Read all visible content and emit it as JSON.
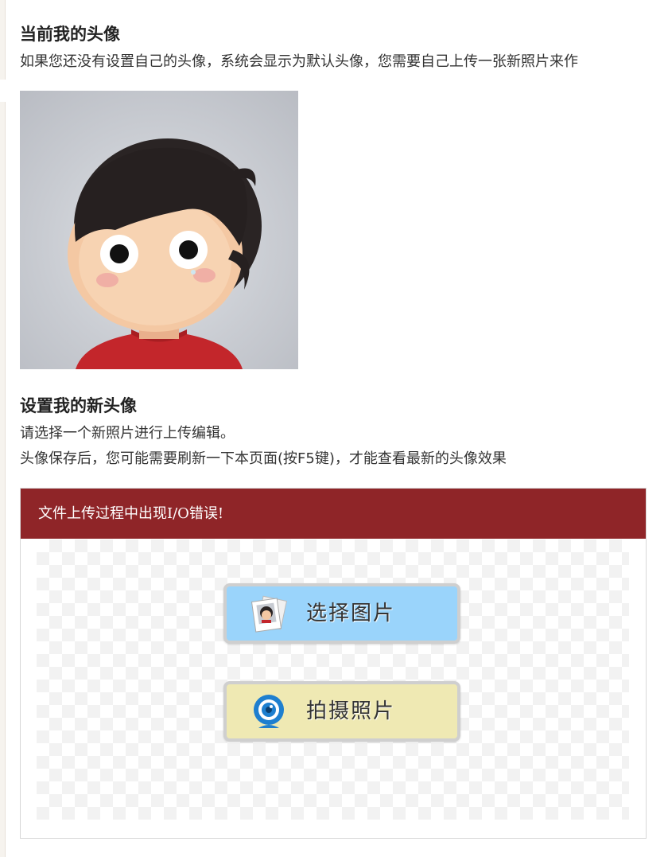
{
  "current_avatar": {
    "title": "当前我的头像",
    "description": "如果您还没有设置自己的头像，系统会显示为默认头像，您需要自己上传一张新照片来作"
  },
  "new_avatar": {
    "title": "设置我的新头像",
    "line1": "请选择一个新照片进行上传编辑。",
    "line2": "头像保存后，您可能需要刷新一下本页面(按F5键)，才能查看最新的头像效果"
  },
  "uploader": {
    "error_message": "文件上传过程中出现I/O错误!",
    "select_button_label": "选择图片",
    "camera_button_label": "拍摄照片",
    "select_button_color": "#9ad4fb",
    "camera_button_color": "#efe9b3",
    "error_bar_color": "#8f2528"
  },
  "icons": {
    "select": "photo-stack-icon",
    "camera": "webcam-icon"
  }
}
